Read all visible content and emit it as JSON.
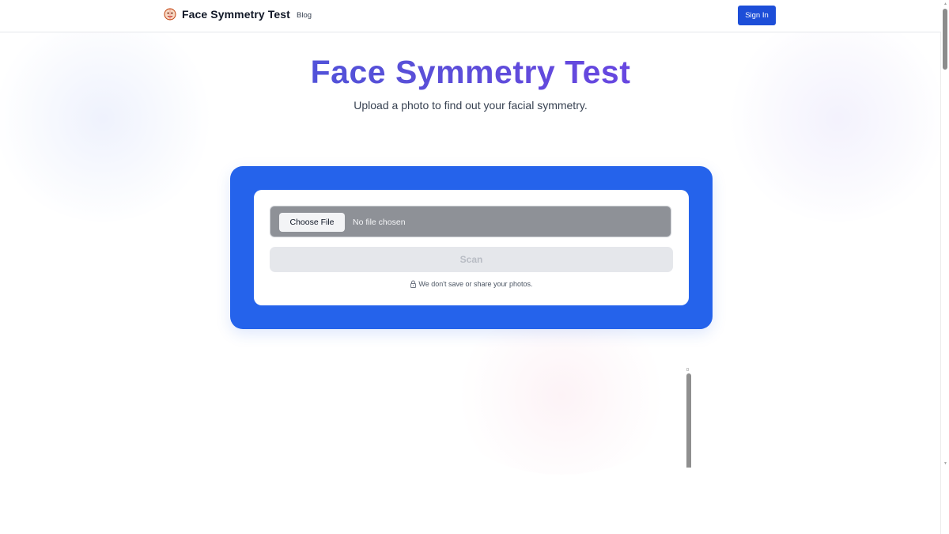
{
  "header": {
    "brand_name": "Face Symmetry Test",
    "nav": [
      {
        "label": "Blog"
      }
    ],
    "signin_label": "Sign In"
  },
  "hero": {
    "title": "Face Symmetry Test",
    "subtitle": "Upload a photo to find out your facial symmetry."
  },
  "upload": {
    "choose_file_label": "Choose File",
    "file_status": "No file chosen",
    "scan_label": "Scan",
    "scan_disabled": true,
    "privacy_note": "We don't save or share your photos."
  },
  "icons": {
    "brand": "face-logo-icon",
    "privacy": "lock-icon"
  },
  "colors": {
    "primary": "#2563eb",
    "signin": "#1d4ed8",
    "title_gradient_start": "#3b5bdb",
    "title_gradient_end": "#7c3aed",
    "file_input_bg": "#8e9197",
    "scan_disabled_bg": "#e5e7eb"
  }
}
